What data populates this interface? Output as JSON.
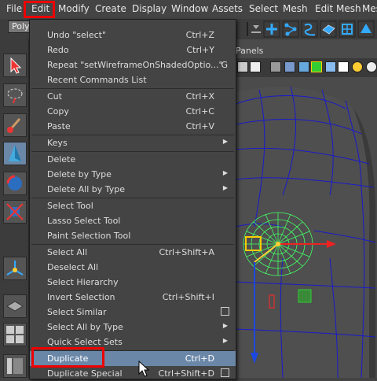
{
  "menubar": {
    "items": [
      "File",
      "Edit",
      "Modify",
      "Create",
      "Display",
      "Window",
      "Assets",
      "Select",
      "Mesh",
      "Edit Mesh",
      "Mes"
    ]
  },
  "shelf": {
    "mode_value": "Poly"
  },
  "viewport": {
    "panels_label": "Panels"
  },
  "edit_menu": {
    "items": [
      {
        "label": "Undo \"select\"",
        "shortcut": "Ctrl+Z"
      },
      {
        "label": "Redo",
        "shortcut": "Ctrl+Y"
      },
      {
        "label": "Repeat \"setWireframeOnShadedOptio...\"",
        "shortcut": "G"
      },
      {
        "label": "Recent Commands List",
        "shortcut": ""
      },
      {
        "label": "Cut",
        "shortcut": "Ctrl+X"
      },
      {
        "label": "Copy",
        "shortcut": "Ctrl+C"
      },
      {
        "label": "Paste",
        "shortcut": "Ctrl+V"
      },
      {
        "label": "Keys",
        "shortcut": ""
      },
      {
        "label": "Delete",
        "shortcut": ""
      },
      {
        "label": "Delete by Type",
        "shortcut": ""
      },
      {
        "label": "Delete All by Type",
        "shortcut": ""
      },
      {
        "label": "Select Tool",
        "shortcut": ""
      },
      {
        "label": "Lasso Select Tool",
        "shortcut": ""
      },
      {
        "label": "Paint Selection Tool",
        "shortcut": ""
      },
      {
        "label": "Select All",
        "shortcut": "Ctrl+Shift+A"
      },
      {
        "label": "Deselect All",
        "shortcut": ""
      },
      {
        "label": "Select Hierarchy",
        "shortcut": ""
      },
      {
        "label": "Invert Selection",
        "shortcut": "Ctrl+Shift+I"
      },
      {
        "label": "Select Similar",
        "shortcut": ""
      },
      {
        "label": "Select All by Type",
        "shortcut": ""
      },
      {
        "label": "Quick Select Sets",
        "shortcut": ""
      },
      {
        "label": "Duplicate",
        "shortcut": "Ctrl+D"
      },
      {
        "label": "Duplicate Special",
        "shortcut": "Ctrl+Shift+D"
      }
    ],
    "highlighted_item": "Duplicate"
  },
  "colors": {
    "highlight_box": "#ee0000",
    "menu_highlight": "#6b87a8",
    "wireframe": "#1a1acc",
    "selection": "#33ff66"
  }
}
